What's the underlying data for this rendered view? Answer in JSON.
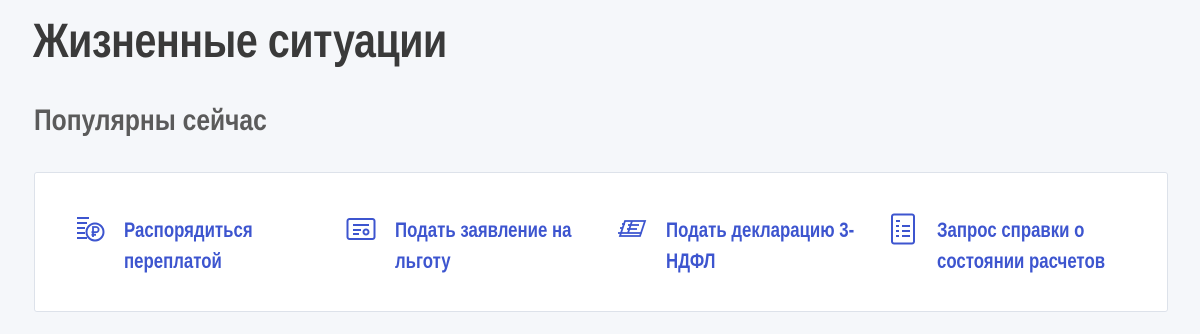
{
  "page": {
    "title": "Жизненные ситуации",
    "section_title": "Популярны сейчас"
  },
  "situations": [
    {
      "label": "Распорядиться переплатой",
      "icon": "coins-ruble-icon"
    },
    {
      "label": "Подать заявление на льготу",
      "icon": "certificate-icon"
    },
    {
      "label": "Подать декларацию 3-НДФЛ",
      "icon": "declaration-stack-icon"
    },
    {
      "label": "Запрос справки о состоянии расчетов",
      "icon": "document-list-icon"
    }
  ],
  "colors": {
    "background": "#f5f7fa",
    "title": "#3a3a3a",
    "subtitle": "#5b5b5b",
    "link": "#3d55cf",
    "icon": "#3d55cf",
    "card_border": "#dde2ea"
  }
}
